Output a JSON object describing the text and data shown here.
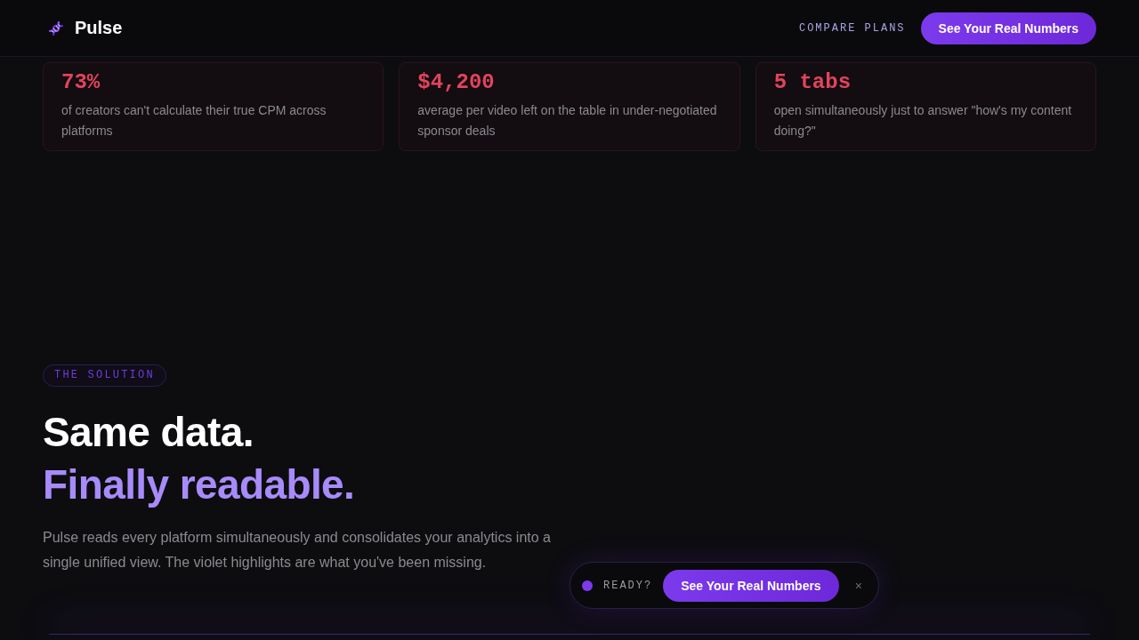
{
  "nav": {
    "brand": "Pulse",
    "link": "COMPARE PLANS",
    "cta": "See Your Real Numbers"
  },
  "stats": [
    {
      "value": "73%",
      "text": "of creators can't calculate their true CPM across platforms"
    },
    {
      "value": "$4,200",
      "text": "average per video left on the table in under-negotiated sponsor deals"
    },
    {
      "value": "5 tabs",
      "text": "open simultaneously just to answer \"how's my content doing?\""
    }
  ],
  "solution": {
    "badge": "THE SOLUTION",
    "heading": "Same data.",
    "highlight": "Finally readable.",
    "body": "Pulse reads every platform simultaneously and consolidates your analytics into a single unified view. The violet highlights are what you've been missing."
  },
  "sticky_bar": {
    "label": "READY?",
    "button": "See Your Real Numbers",
    "close": "×"
  }
}
